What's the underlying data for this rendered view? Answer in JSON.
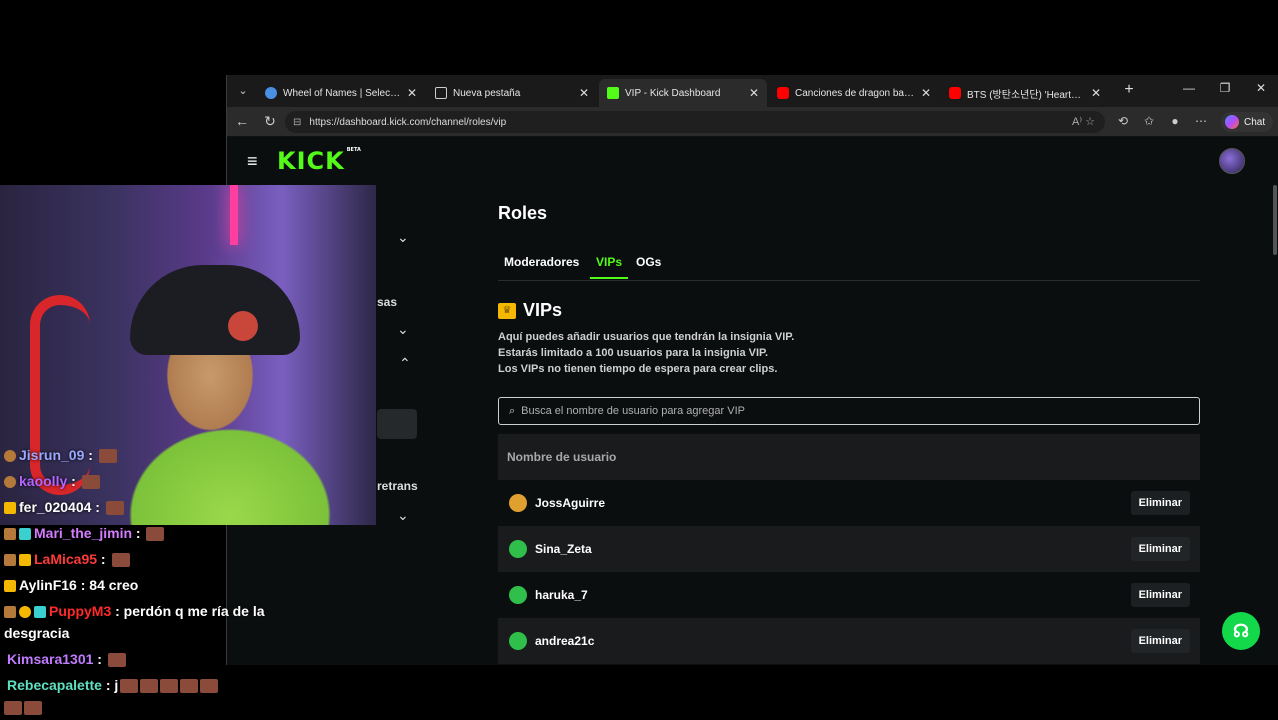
{
  "browser": {
    "tabs": [
      {
        "label": "Wheel of Names | Selector de n",
        "icon_color": "#4a90e2",
        "active": false
      },
      {
        "label": "Nueva pestaña",
        "icon_color": "#888888",
        "active": false
      },
      {
        "label": "VIP - Kick Dashboard",
        "icon_color": "#53fc18",
        "active": true
      },
      {
        "label": "Canciones de dragon ball z pel",
        "icon_color": "#ff0000",
        "active": false
      },
      {
        "label": "BTS (방탄소년단) 'Heartbeat (B",
        "icon_color": "#ff0000",
        "active": false
      }
    ],
    "url": "https://dashboard.kick.com/channel/roles/vip",
    "chat_label": "Chat"
  },
  "kick": {
    "logo": "KICK",
    "logo_tag": "BETA",
    "sidebar_fragments": [
      "sas",
      "retrans"
    ],
    "roles_title": "Roles",
    "tabs": [
      "Moderadores",
      "VIPs",
      "OGs"
    ],
    "active_tab": "VIPs",
    "vip_title": "VIPs",
    "description": [
      "Aquí puedes añadir usuarios que tendrán la insignia VIP.",
      "Estarás limitado a 100 usuarios para la insignia VIP.",
      "Los VIPs no tienen tiempo de espera para crear clips."
    ],
    "search_placeholder": "Busca el nombre de usuario para agregar VIP",
    "table_header": "Nombre de usuario",
    "delete_label": "Eliminar",
    "users": [
      {
        "name": "JossAguirre",
        "avatar_color": "#e0a030"
      },
      {
        "name": "Sina_Zeta",
        "avatar_color": "#2fbf4a"
      },
      {
        "name": "haruka_7",
        "avatar_color": "#2fbf4a"
      },
      {
        "name": "andrea21c",
        "avatar_color": "#2fbf4a"
      }
    ]
  },
  "chat": [
    {
      "user": "Jisrun_09",
      "user_color": "#9aa8ff",
      "text": " : ",
      "emotes": 1
    },
    {
      "user": "kaoolly",
      "user_color": "#b565ff",
      "text": " : ",
      "emotes": 1
    },
    {
      "user": "fer_020404",
      "user_color": "#ffffff",
      "text": " : ",
      "emotes": 1
    },
    {
      "user": "Mari_the_jimin",
      "user_color": "#d47bff",
      "text": " : ",
      "emotes": 1
    },
    {
      "user": "LaMica95",
      "user_color": "#ff3a3a",
      "text": " : ",
      "emotes": 1
    },
    {
      "user": "AylinF16",
      "user_color": "#ffffff",
      "text": " : 84 creo",
      "emotes": 0
    },
    {
      "user": "PuppyM3",
      "user_color": "#ff2a2a",
      "text": " : perdón q me ría de la",
      "emotes": 0
    },
    {
      "user": "",
      "user_color": "#ffffff",
      "text": "desgracia",
      "emotes": 0
    },
    {
      "user": "Kimsara1301",
      "user_color": "#c07bff",
      "text": " : ",
      "emotes": 1
    },
    {
      "user": "Rebecapalette",
      "user_color": "#5fe0c0",
      "text": " : j",
      "emotes": 5
    },
    {
      "user": "",
      "user_color": "#ffffff",
      "text": "",
      "emotes": 2
    }
  ]
}
